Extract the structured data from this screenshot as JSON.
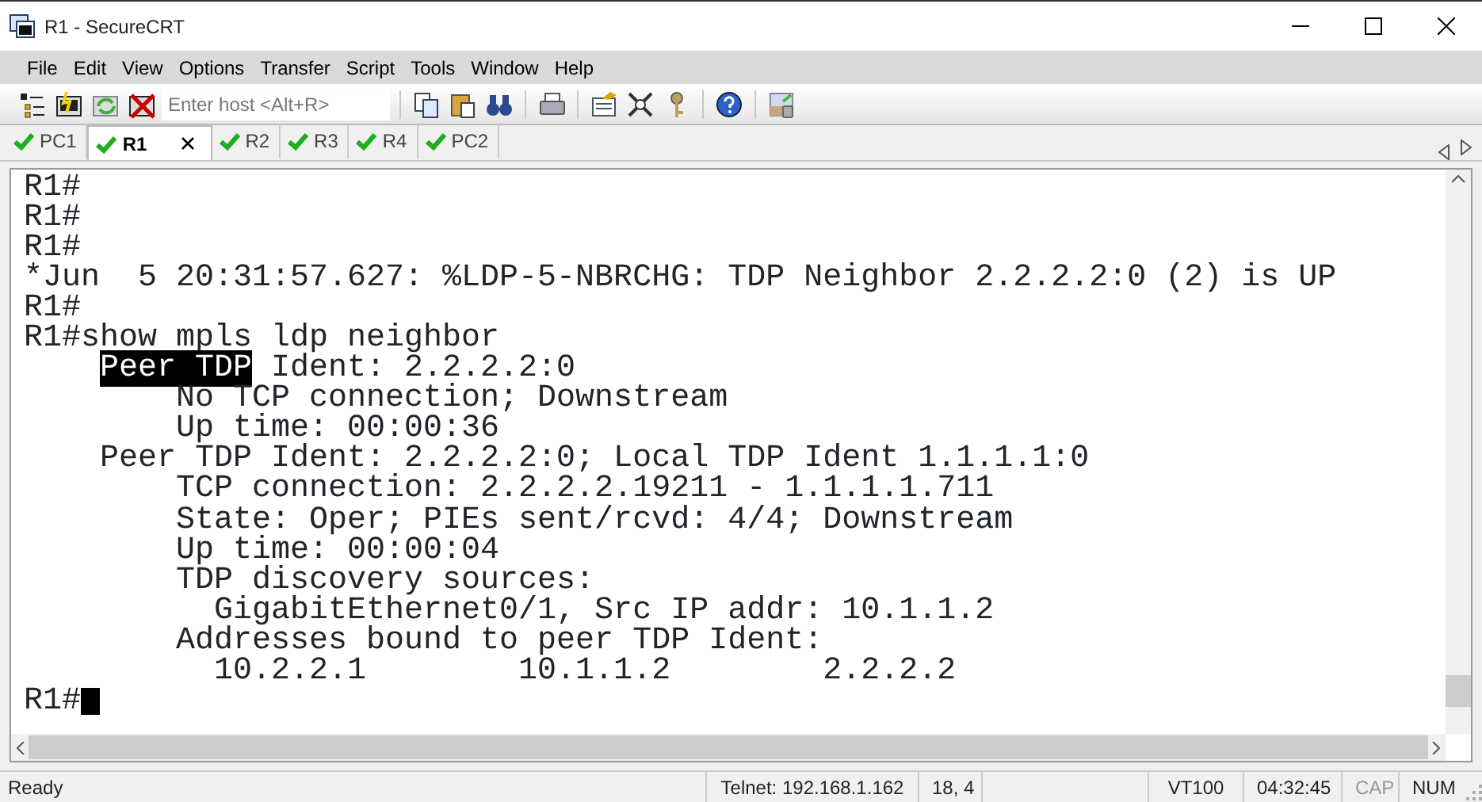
{
  "window": {
    "title": "R1 - SecureCRT"
  },
  "menu": [
    "File",
    "Edit",
    "View",
    "Options",
    "Transfer",
    "Script",
    "Tools",
    "Window",
    "Help"
  ],
  "toolbar": {
    "host_field": {
      "placeholder": "Enter host <Alt+R>"
    }
  },
  "tabs": [
    {
      "label": "PC1",
      "selected": false,
      "connected": true
    },
    {
      "label": "R1",
      "selected": true,
      "connected": true
    },
    {
      "label": "R2",
      "selected": false,
      "connected": true
    },
    {
      "label": "R3",
      "selected": false,
      "connected": true
    },
    {
      "label": "R4",
      "selected": false,
      "connected": true
    },
    {
      "label": "PC2",
      "selected": false,
      "connected": true
    }
  ],
  "terminal": {
    "lines": [
      {
        "parts": [
          {
            "text": "R1#",
            "selected": false
          }
        ]
      },
      {
        "parts": [
          {
            "text": "R1#",
            "selected": false
          }
        ]
      },
      {
        "parts": [
          {
            "text": "R1#",
            "selected": false
          }
        ]
      },
      {
        "parts": [
          {
            "text": "*Jun  5 20:31:57.627: %LDP-5-NBRCHG: TDP Neighbor 2.2.2.2:0 (2) is UP",
            "selected": false
          }
        ]
      },
      {
        "parts": [
          {
            "text": "R1#",
            "selected": false
          }
        ]
      },
      {
        "parts": [
          {
            "text": "R1#show mpls ldp neighbor",
            "selected": false
          }
        ]
      },
      {
        "kind": "indented",
        "parts": [
          {
            "text": "Peer TDP",
            "selected": true
          },
          {
            "text": " Ident: 2.2.2.2:0",
            "selected": false
          }
        ]
      },
      {
        "parts": [
          {
            "text": "        No TCP connection; Downstream",
            "selected": false
          }
        ]
      },
      {
        "parts": [
          {
            "text": "        Up time: 00:00:36",
            "selected": false
          }
        ]
      },
      {
        "parts": [
          {
            "text": "    Peer TDP Ident: 2.2.2.2:0; Local TDP Ident 1.1.1.1:0",
            "selected": false
          }
        ]
      },
      {
        "parts": [
          {
            "text": "        TCP connection: 2.2.2.2.19211 - 1.1.1.1.711",
            "selected": false
          }
        ]
      },
      {
        "parts": [
          {
            "text": "        State: Oper; PIEs sent/rcvd: 4/4; Downstream",
            "selected": false
          }
        ]
      },
      {
        "parts": [
          {
            "text": "        Up time: 00:00:04",
            "selected": false
          }
        ]
      },
      {
        "parts": [
          {
            "text": "        TDP discovery sources:",
            "selected": false
          }
        ]
      },
      {
        "parts": [
          {
            "text": "          GigabitEthernet0/1, Src IP addr: 10.1.1.2",
            "selected": false
          }
        ]
      },
      {
        "parts": [
          {
            "text": "        Addresses bound to peer TDP Ident:",
            "selected": false
          }
        ]
      },
      {
        "parts": [
          {
            "text": "          10.2.2.1        10.1.1.2        2.2.2.2",
            "selected": false
          }
        ]
      },
      {
        "parts": [
          {
            "text": "R1#",
            "selected": false
          }
        ],
        "cursor": true
      }
    ]
  },
  "status_bar": [
    {
      "text": "Ready",
      "disabled": false
    },
    {
      "text": "Telnet: 192.168.1.162",
      "disabled": false
    },
    {
      "text": "18,  4",
      "disabled": false
    },
    {
      "text": "VT100",
      "disabled": false
    },
    {
      "text": "04:32:45",
      "disabled": false
    },
    {
      "text": "CAP",
      "disabled": true
    },
    {
      "text": "NUM",
      "disabled": false
    }
  ]
}
